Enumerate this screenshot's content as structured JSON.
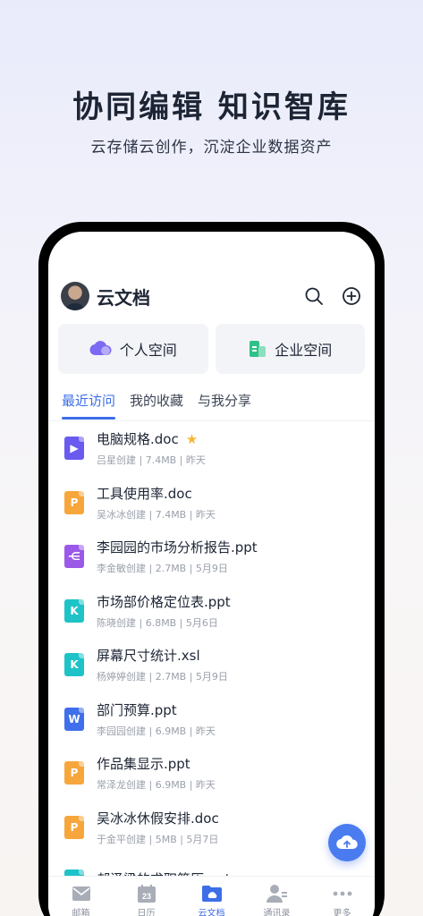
{
  "hero": {
    "title": "协同编辑 知识智库",
    "subtitle": "云存储云创作，沉淀企业数据资产"
  },
  "header": {
    "title": "云文档"
  },
  "spaces": [
    {
      "label": "个人空间",
      "icon": "cloud-icon"
    },
    {
      "label": "企业空间",
      "icon": "building-icon"
    }
  ],
  "tabs": [
    {
      "label": "最近访问",
      "active": true
    },
    {
      "label": "我的收藏",
      "active": false
    },
    {
      "label": "与我分享",
      "active": false
    }
  ],
  "files": [
    {
      "name": "电脑规格.doc",
      "meta": "吕星创建 | 7.4MB | 昨天",
      "type": "video",
      "color": "#6a5af0",
      "glyph": "▶",
      "starred": true
    },
    {
      "name": "工具使用率.doc",
      "meta": "吴冰冰创建 | 7.4MB | 昨天",
      "type": "ppt",
      "color": "#f7a63b",
      "glyph": "P",
      "starred": false
    },
    {
      "name": "李园园的市场分析报告.ppt",
      "meta": "李金敏创建 | 2.7MB | 5月9日",
      "type": "mindmap",
      "color": "#9b59e8",
      "glyph": "⋲",
      "starred": false
    },
    {
      "name": "市场部价格定位表.ppt",
      "meta": "陈晓创建 | 6.8MB | 5月6日",
      "type": "keynote",
      "color": "#1ec3c8",
      "glyph": "K",
      "starred": false
    },
    {
      "name": "屏幕尺寸统计.xsl",
      "meta": "杨婷婷创建 | 2.7MB | 5月9日",
      "type": "keynote",
      "color": "#1ec3c8",
      "glyph": "K",
      "starred": false
    },
    {
      "name": "部门预算.ppt",
      "meta": "李园园创建 | 6.9MB | 昨天",
      "type": "word",
      "color": "#3f6fea",
      "glyph": "W",
      "starred": false
    },
    {
      "name": "作品集显示.ppt",
      "meta": "常泽龙创建 | 6.9MB | 昨天",
      "type": "ppt",
      "color": "#f7a63b",
      "glyph": "P",
      "starred": false
    },
    {
      "name": "吴冰冰休假安排.doc",
      "meta": "于金平创建 | 5MB | 5月7日",
      "type": "ppt",
      "color": "#f7a63b",
      "glyph": "P",
      "starred": false
    },
    {
      "name": "郝泽梁的求职简历.ppt",
      "meta": "",
      "type": "keynote",
      "color": "#1ec3c8",
      "glyph": "K",
      "starred": false
    }
  ],
  "nav": [
    {
      "label": "邮箱",
      "icon": "mail-icon",
      "active": false
    },
    {
      "label": "日历",
      "icon": "calendar-icon",
      "active": false,
      "date": "23"
    },
    {
      "label": "云文档",
      "icon": "folder-cloud-icon",
      "active": true
    },
    {
      "label": "通讯录",
      "icon": "contacts-icon",
      "active": false
    },
    {
      "label": "更多",
      "icon": "more-icon",
      "active": false
    }
  ],
  "colors": {
    "accent": "#3d6ee8",
    "fab": "#4a7cf0",
    "star": "#f5b731"
  }
}
